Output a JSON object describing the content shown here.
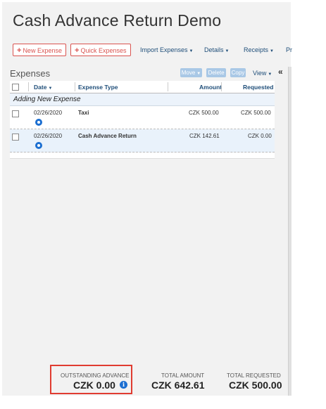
{
  "title": "Cash Advance Return Demo",
  "toolbar": {
    "new_expense": "New Expense",
    "quick_expenses": "Quick Expenses",
    "import_expenses": "Import Expenses",
    "details": "Details",
    "receipts": "Receipts",
    "more": "Pr"
  },
  "expenses": {
    "section_title": "Expenses",
    "move": "Move",
    "delete": "Delete",
    "copy": "Copy",
    "view": "View",
    "collapse": "«",
    "columns": {
      "date": "Date",
      "expense_type": "Expense Type",
      "amount": "Amount",
      "requested": "Requested"
    },
    "adding_new": "Adding New Expense",
    "rows": [
      {
        "date": "02/26/2020",
        "type": "Taxi",
        "amount": "CZK 500.00",
        "requested": "CZK 500.00"
      },
      {
        "date": "02/26/2020",
        "type": "Cash Advance Return",
        "amount": "CZK 142.61",
        "requested": "CZK 0.00"
      }
    ]
  },
  "totals": {
    "outstanding_label": "OUTSTANDING ADVANCE",
    "outstanding_value": "CZK 0.00",
    "total_amount_label": "TOTAL AMOUNT",
    "total_amount_value": "CZK 642.61",
    "total_requested_label": "TOTAL REQUESTED",
    "total_requested_value": "CZK 500.00"
  },
  "colors": {
    "accent_red": "#d9534f",
    "link_blue": "#1f4e79",
    "highlight_box": "#e03c31"
  }
}
